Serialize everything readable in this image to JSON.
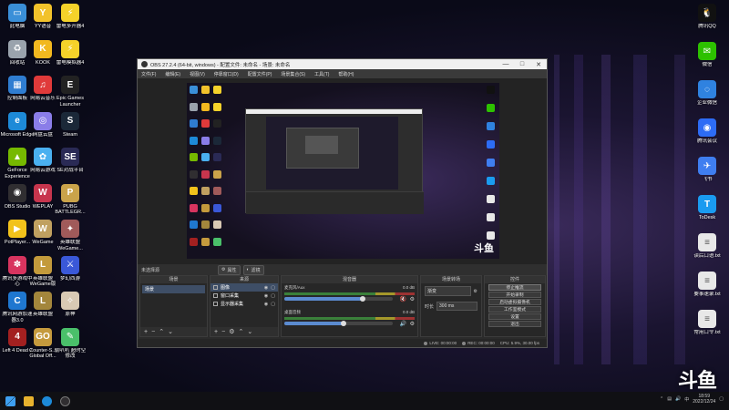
{
  "desktop": {
    "left_icons": [
      {
        "label": "此电脑",
        "color": "#3a8fd8",
        "glyph": "▭",
        "icon": "computer-icon"
      },
      {
        "label": "YY语音",
        "color": "#f2c22b",
        "glyph": "Y",
        "icon": "yy-icon"
      },
      {
        "label": "雷电多开器4",
        "color": "#f5d22a",
        "glyph": "⚡",
        "icon": "ldplayer-multi-icon"
      },
      {
        "label": "回收站",
        "color": "#9aa3ad",
        "glyph": "♻",
        "icon": "recycle-bin-icon"
      },
      {
        "label": "KOOK",
        "color": "#f2b81f",
        "glyph": "K",
        "icon": "kook-icon"
      },
      {
        "label": "雷电模拟器4",
        "color": "#f5d22a",
        "glyph": "⚡",
        "icon": "ldplayer-icon"
      },
      {
        "label": "控制面板",
        "color": "#2f7dd1",
        "glyph": "▦",
        "icon": "control-panel-icon"
      },
      {
        "label": "网易云音乐",
        "color": "#e03a3a",
        "glyph": "♫",
        "icon": "netease-music-icon"
      },
      {
        "label": "Epic Games Launcher",
        "color": "#222222",
        "glyph": "E",
        "icon": "epic-games-icon"
      },
      {
        "label": "Microsoft Edge",
        "color": "#1d8ad8",
        "glyph": "e",
        "icon": "edge-icon"
      },
      {
        "label": "网盘云盘",
        "color": "#8a7de8",
        "glyph": "◎",
        "icon": "cloud-disk-icon"
      },
      {
        "label": "Steam",
        "color": "#1b2838",
        "glyph": "S",
        "icon": "steam-icon"
      },
      {
        "label": "GeForce Experience",
        "color": "#76b900",
        "glyph": "▲",
        "icon": "geforce-icon"
      },
      {
        "label": "网易云游戏",
        "color": "#4ab0f0",
        "glyph": "✿",
        "icon": "netease-cloud-game-icon"
      },
      {
        "label": "SE对战平台",
        "color": "#2a2a55",
        "glyph": "SE",
        "icon": "se-platform-icon"
      },
      {
        "label": "OBS Studio",
        "color": "#302e31",
        "glyph": "◉",
        "icon": "obs-icon"
      },
      {
        "label": "WEPLAY",
        "color": "#c7354d",
        "glyph": "W",
        "icon": "weplay-icon"
      },
      {
        "label": "PUBG BATTLEGR...",
        "color": "#caa34a",
        "glyph": "P",
        "icon": "pubg-icon"
      },
      {
        "label": "PotPlayer...",
        "color": "#f2c21b",
        "glyph": "▶",
        "icon": "potplayer-icon"
      },
      {
        "label": "WeGame",
        "color": "#c0a060",
        "glyph": "W",
        "icon": "wegame-icon"
      },
      {
        "label": "英雄联盟WeGame...",
        "color": "#a05a5a",
        "glyph": "✦",
        "icon": "lol-wegame-icon"
      },
      {
        "label": "腾讯多游戏中心",
        "color": "#d8345f",
        "glyph": "✽",
        "icon": "tencent-game-center-icon"
      },
      {
        "label": "英雄联盟WeGame版",
        "color": "#c39a3c",
        "glyph": "L",
        "icon": "lol-icon"
      },
      {
        "label": "梦幻西游",
        "color": "#3a58d8",
        "glyph": "⚔",
        "icon": "game-icon"
      },
      {
        "label": "腾讯网游加速器3.0",
        "color": "#1f77d0",
        "glyph": "C",
        "icon": "accelerator-icon"
      },
      {
        "label": "英雄联盟",
        "color": "#a3863c",
        "glyph": "L",
        "icon": "league-icon"
      },
      {
        "label": "原神",
        "color": "#d9c9b4",
        "glyph": "✧",
        "icon": "genshin-icon"
      },
      {
        "label": "Left 4 Dead 2",
        "color": "#a32020",
        "glyph": "4",
        "icon": "l4d2-icon"
      },
      {
        "label": "Counter-S... Global Off...",
        "color": "#c59a3d",
        "glyph": "GO",
        "icon": "csgo-icon"
      },
      {
        "label": "偷叭叭 超时空 修改",
        "color": "#4ac06a",
        "glyph": "✎",
        "icon": "editor-icon"
      }
    ],
    "right_icons": [
      {
        "label": "腾讯QQ",
        "color": "#111111",
        "glyph": "🐧",
        "icon": "qq-icon"
      },
      {
        "label": "微信",
        "color": "#2dc100",
        "glyph": "✉",
        "icon": "wechat-icon"
      },
      {
        "label": "企业微信",
        "color": "#2f82e0",
        "glyph": "◌",
        "icon": "wecom-icon"
      },
      {
        "label": "腾讯会议",
        "color": "#2d6cf5",
        "glyph": "◉",
        "icon": "tencent-meeting-icon"
      },
      {
        "label": "飞书",
        "color": "#3f7ef0",
        "glyph": "✈",
        "icon": "feishu-icon"
      },
      {
        "label": "ToDesk",
        "color": "#1a9bf0",
        "glyph": "T",
        "icon": "todesk-icon"
      },
      {
        "label": "读后口语.txt",
        "color": "#e8e8e8",
        "glyph": "≡",
        "icon": "text-file-icon"
      },
      {
        "label": "要事速录.txt",
        "color": "#e8e8e8",
        "glyph": "≡",
        "icon": "text-file-icon"
      },
      {
        "label": "常用口令.txt",
        "color": "#e8e8e8",
        "glyph": "≡",
        "icon": "text-file-icon"
      }
    ]
  },
  "obs": {
    "title": "OBS 27.2.4 (64-bit, windows) - 配置文件: 未命名 - 场景: 未命名",
    "window_buttons": [
      "—",
      "□",
      "✕"
    ],
    "menu": [
      "文件(F)",
      "编辑(E)",
      "视图(V)",
      "停靠窗口(D)",
      "配置文件(P)",
      "场景集合(S)",
      "工具(T)",
      "帮助(H)"
    ],
    "watermark": "斗鱼",
    "scene_toolbar": {
      "label": "未选择源",
      "props_btn": "属性",
      "filters_btn": "滤镜"
    },
    "scenes": {
      "header": "场景",
      "items": [
        "场景"
      ]
    },
    "sources": {
      "header": "来源",
      "items": [
        "图像",
        "窗口采集",
        "显示器采集"
      ]
    },
    "mixer": {
      "header": "混音器",
      "tracks": [
        {
          "name": "麦克风/Aux",
          "db": "0.0 dB",
          "level": 0.72
        },
        {
          "name": "桌面音频",
          "db": "0.0 dB",
          "level": 0.55
        }
      ]
    },
    "transitions": {
      "header": "场景转场",
      "selected": "渐变",
      "duration_label": "时长",
      "duration_value": "300 ms"
    },
    "controls": {
      "header": "控件",
      "buttons": [
        "停止推流",
        "开始录制",
        "启动虚拟摄像机",
        "工作室模式",
        "设置",
        "退出"
      ]
    },
    "status": {
      "live": "LIVE: 00:00:00",
      "rec": "REC: 00:00:00",
      "cpu": "CPU: 5.9%, 30.00 fps"
    }
  },
  "taskbar": {
    "tray_lang": "中",
    "time": "18:59",
    "date": "2022/12/24"
  },
  "watermark_big": "斗鱼"
}
